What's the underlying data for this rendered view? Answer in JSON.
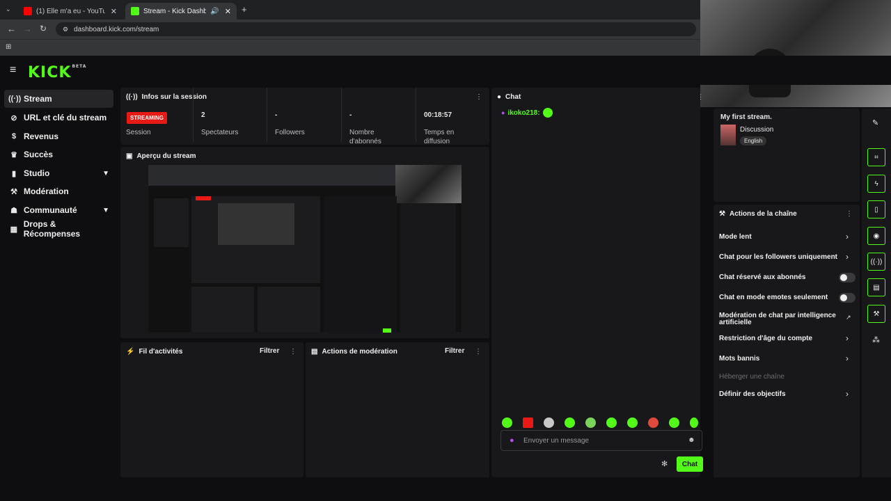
{
  "browser": {
    "tabs": [
      {
        "label": "(1) Elle m'a eu - YouTube"
      },
      {
        "label": "Stream - Kick Dashboard"
      }
    ],
    "url": "dashboard.kick.com/stream"
  },
  "app": {
    "logo": "KICK",
    "logo_badge": "BETA"
  },
  "sidebar": {
    "items": [
      {
        "label": "Stream",
        "icon": "stream-icon"
      },
      {
        "label": "URL et clé du stream",
        "icon": "link-icon"
      },
      {
        "label": "Revenus",
        "icon": "dollar-icon"
      },
      {
        "label": "Succès",
        "icon": "trophy-icon"
      },
      {
        "label": "Studio",
        "icon": "studio-icon"
      },
      {
        "label": "Modération",
        "icon": "wrench-icon"
      },
      {
        "label": "Communauté",
        "icon": "community-icon"
      },
      {
        "label": "Drops & Récompenses",
        "icon": "gift-icon"
      }
    ]
  },
  "session": {
    "title": "Infos sur la session",
    "status": "STREAMING",
    "status_label": "Session",
    "stats": [
      {
        "value": "2",
        "label": "Spectateurs"
      },
      {
        "value": "-",
        "label": "Followers"
      },
      {
        "value": "-",
        "label": "Nombre d'abonnés"
      },
      {
        "value": "00:18:57",
        "label": "Temps en diffusion"
      }
    ]
  },
  "preview": {
    "title": "Aperçu du stream"
  },
  "activity": {
    "title": "Fil d'activités",
    "filter": "Filtrer"
  },
  "moderation": {
    "title": "Actions de modération",
    "filter": "Filtrer"
  },
  "chat": {
    "title": "Chat",
    "messages": [
      {
        "user": "ikoko218:"
      }
    ],
    "input_placeholder": "Envoyer un message",
    "send_label": "Chat"
  },
  "stream_info": {
    "title": "My first stream.",
    "category": "Discussion",
    "language": "English"
  },
  "channel_actions": {
    "title": "Actions de la chaîne",
    "items": [
      {
        "label": "Mode lent",
        "control": "arrow"
      },
      {
        "label": "Chat pour les followers uniquement",
        "control": "arrow"
      },
      {
        "label": "Chat réservé aux abonnés",
        "control": "toggle"
      },
      {
        "label": "Chat en mode emotes seulement",
        "control": "toggle"
      },
      {
        "label": "Modération de chat par intelligence artificielle",
        "control": "external"
      },
      {
        "label": "Restriction d'âge du compte",
        "control": "arrow"
      },
      {
        "label": "Mots bannis",
        "control": "arrow"
      },
      {
        "label": "Héberger une chaîne",
        "control": "none"
      },
      {
        "label": "Définir des objectifs",
        "control": "arrow"
      }
    ]
  },
  "colors": {
    "accent": "#53fc18",
    "live": "#e91916",
    "panel": "#18181b",
    "background": "#0e0e10"
  }
}
